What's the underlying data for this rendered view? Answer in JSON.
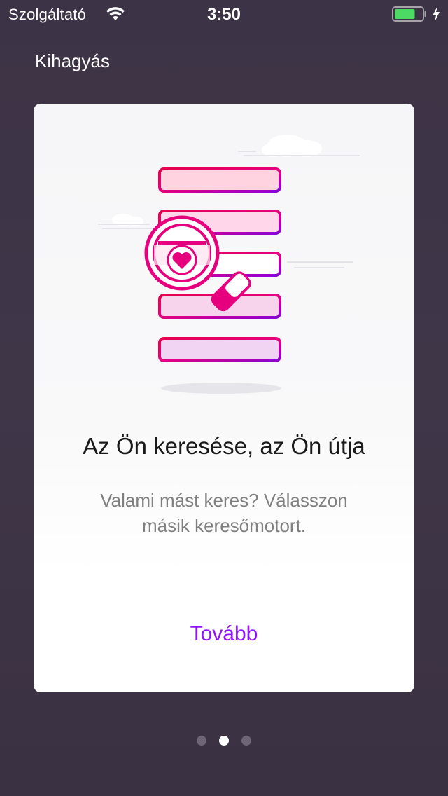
{
  "status_bar": {
    "carrier": "Szolgáltató",
    "time": "3:50",
    "wifi_icon": "wifi-icon",
    "battery_icon": "battery-icon",
    "charging_icon": "charging-bolt-icon",
    "battery_level": 0.75,
    "battery_color": "#4cd964"
  },
  "nav": {
    "skip_label": "Kihagyás"
  },
  "card": {
    "illustration_icon": "search-results-magnifier-heart-illustration",
    "title": "Az Ön keresése, az Ön útja",
    "subtitle": "Valami mást keres? Válasszon másik keresőmotort.",
    "next_label": "Tovább"
  },
  "pager": {
    "total": 3,
    "current": 2
  },
  "colors": {
    "accent": "#9013fe",
    "pink": "#e6007e",
    "background": "#3d3346"
  }
}
